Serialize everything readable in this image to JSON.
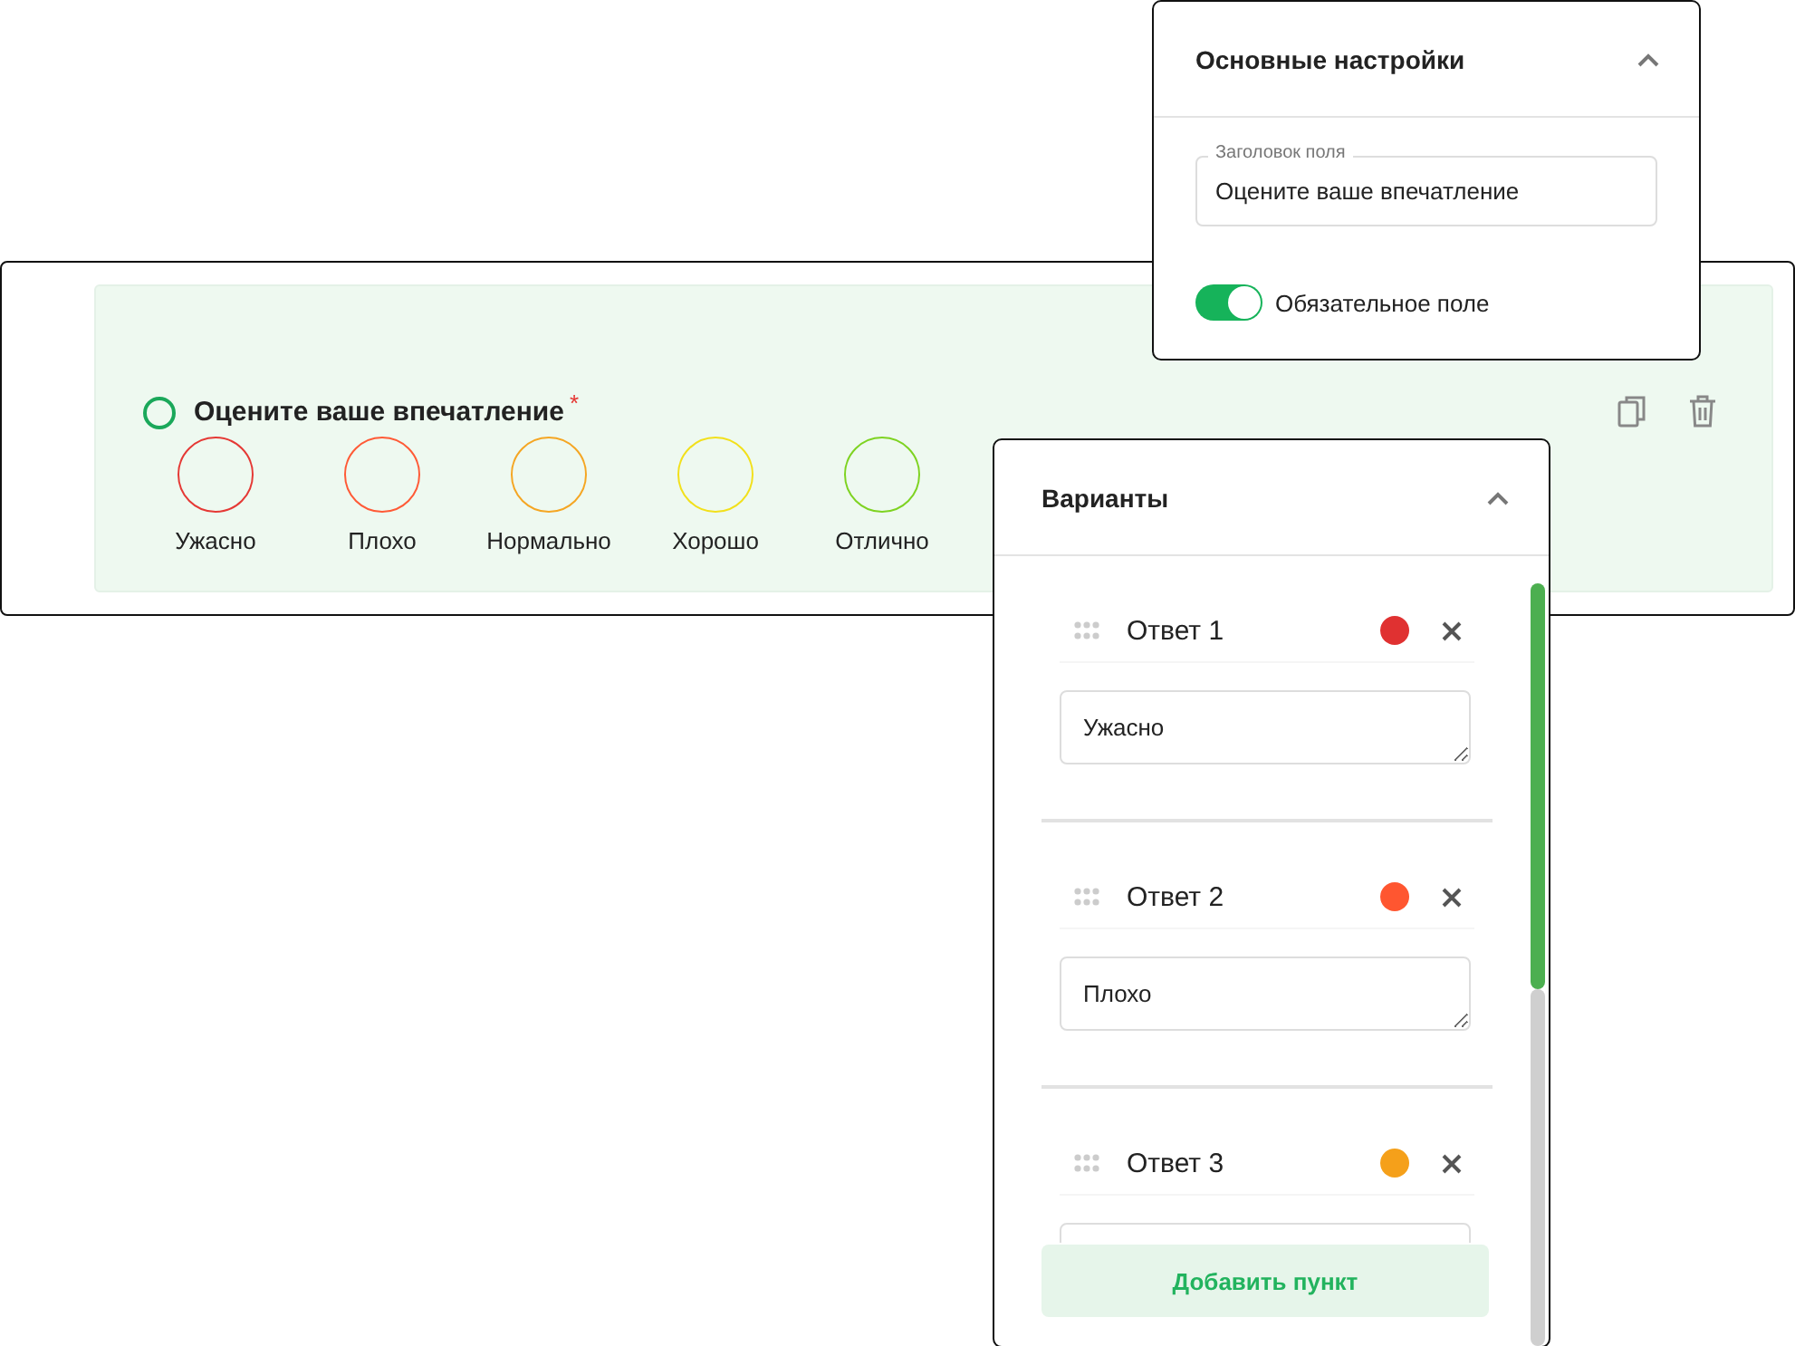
{
  "question": {
    "title": "Оцените ваше впечатление",
    "required": true,
    "required_mark": "*",
    "options": [
      {
        "label": "Ужасно",
        "color": "#e53935"
      },
      {
        "label": "Плохо",
        "color": "#ff5a36"
      },
      {
        "label": "Нормально",
        "color": "#f5a623"
      },
      {
        "label": "Хорошо",
        "color": "#f2e01b"
      },
      {
        "label": "Отлично",
        "color": "#7ed321"
      }
    ]
  },
  "basic_settings": {
    "title": "Основные настройки",
    "expanded": true,
    "field_title": {
      "label": "Заголовок поля",
      "value": "Оцените ваше впечатление"
    },
    "required_toggle": {
      "label": "Обязательное поле",
      "on": true
    }
  },
  "variants": {
    "title": "Варианты",
    "expanded": true,
    "answers": [
      {
        "label": "Ответ 1",
        "color": "#e03131",
        "value": "Ужасно"
      },
      {
        "label": "Ответ 2",
        "color": "#ff5630",
        "value": "Плохо"
      },
      {
        "label": "Ответ 3",
        "color": "#f5a01a"
      }
    ],
    "add_button": "Добавить пункт"
  }
}
